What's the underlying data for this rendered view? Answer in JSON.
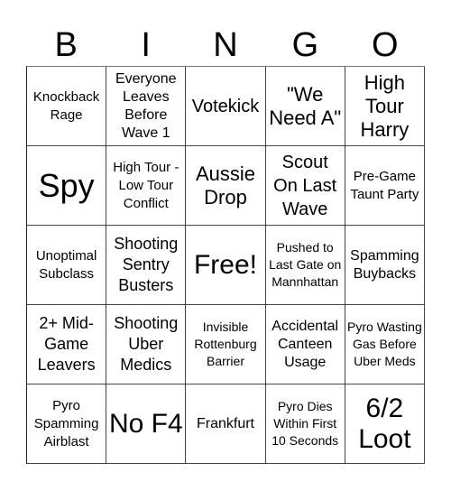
{
  "header": [
    "B",
    "I",
    "N",
    "G",
    "O"
  ],
  "cells": [
    [
      "Knockback Rage",
      "Everyone Leaves Before Wave 1",
      "Votekick",
      "\"We Need A\"",
      "High Tour Harry"
    ],
    [
      "Spy",
      "High Tour - Low Tour Conflict",
      "Aussie Drop",
      "Scout On Last Wave",
      "Pre-Game Taunt Party"
    ],
    [
      "Unoptimal Subclass",
      "Shooting Sentry Busters",
      "Free!",
      "Pushed to Last Gate on Mannhattan",
      "Spamming Buybacks"
    ],
    [
      "2+ Mid-Game Leavers",
      "Shooting Uber Medics",
      "Invisible Rottenburg Barrier",
      "Accidental Canteen Usage",
      "Pyro Wasting Gas Before Uber Meds"
    ],
    [
      "Pyro Spamming Airblast",
      "No F4",
      "Frankfurt",
      "Pyro Dies Within First 10 Seconds",
      "6/2 Loot"
    ]
  ]
}
